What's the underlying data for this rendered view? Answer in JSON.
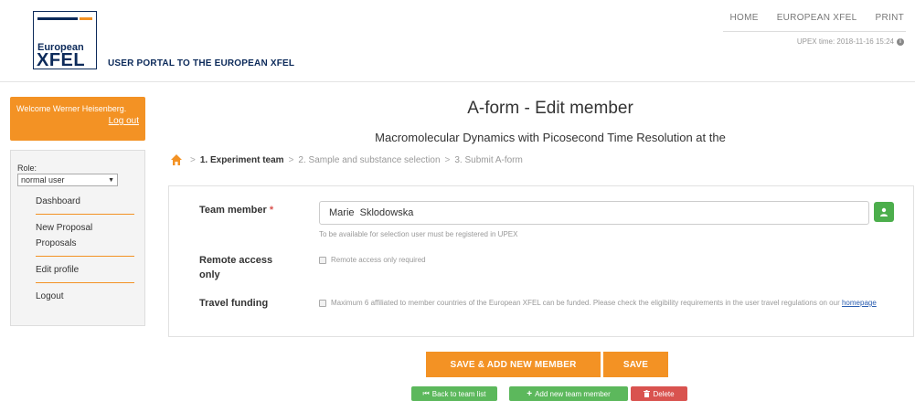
{
  "header": {
    "logo_line1": "European",
    "logo_line2": "XFEL",
    "portal_title": "USER PORTAL TO THE EUROPEAN XFEL",
    "nav": [
      "HOME",
      "EUROPEAN XFEL",
      "PRINT"
    ],
    "upex_time": "UPEX time: 2018-11-16 15:24"
  },
  "sidebar": {
    "welcome": "Welcome Werner Heisenberg.",
    "logout_link": "Log out",
    "role_label": "Role:",
    "role_value": "normal user",
    "menu": [
      "Dashboard",
      "New Proposal",
      "Proposals",
      "Edit profile",
      "Logout"
    ]
  },
  "main": {
    "title": "A-form - Edit member",
    "subtitle": "Macromolecular Dynamics with Picosecond Time Resolution at the",
    "steps": [
      "1. Experiment team",
      "2. Sample and substance selection",
      "3. Submit A-form"
    ],
    "step_separator": ">"
  },
  "form": {
    "team_member_label": "Team member",
    "required_mark": "*",
    "team_member_value": "Marie  Sklodowska",
    "team_member_help": "To be available for selection user must be registered in UPEX",
    "remote_label": "Remote access only",
    "remote_text": "Remote access only required",
    "travel_label": "Travel funding",
    "travel_text": "Maximum 6 affiliated to member countries of the European XFEL can be funded. Please check the eligibility requirements in the user travel regulations on our",
    "homepage_link": "homepage"
  },
  "buttons": {
    "save_add": "SAVE & ADD NEW MEMBER",
    "save": "SAVE",
    "back": "Back to team list",
    "add_member": "Add new team member",
    "delete": "Delete"
  },
  "colors": {
    "accent_orange": "#f39224",
    "brand_navy": "#0c2a5a",
    "green": "#5cb85c",
    "red": "#d9534f"
  },
  "icons": [
    "home-icon",
    "info-icon",
    "user-icon",
    "chevron-down-icon",
    "back-icon",
    "plus-icon",
    "trash-icon"
  ]
}
